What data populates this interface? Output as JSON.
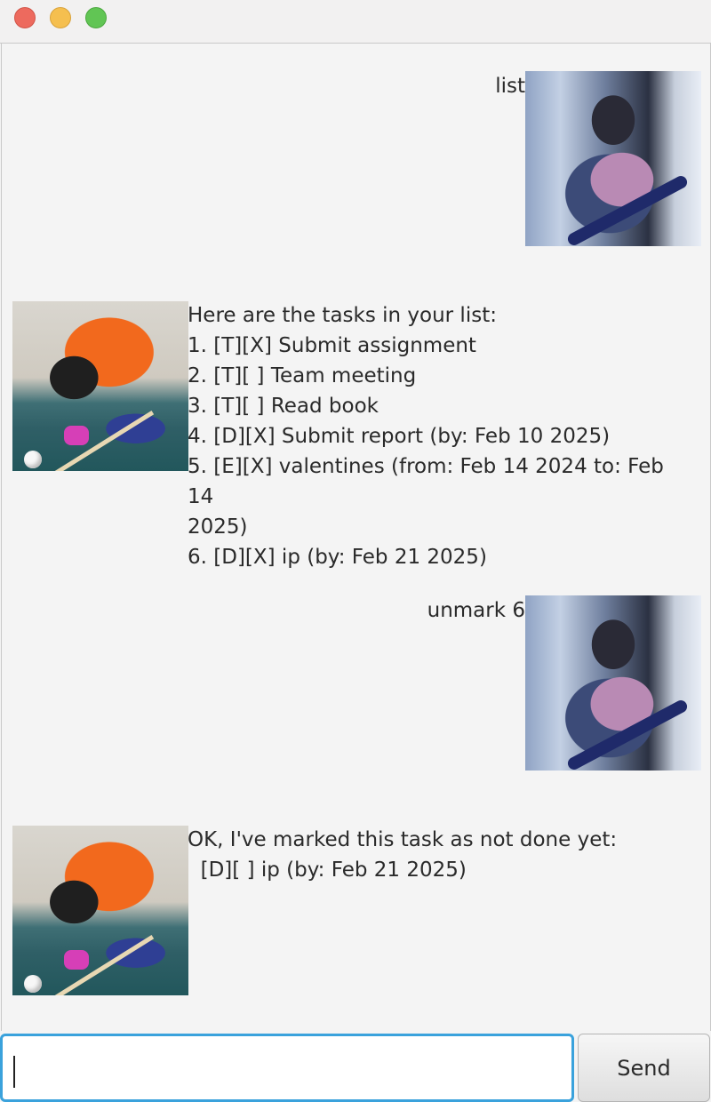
{
  "window": {
    "controls": [
      "close",
      "minimize",
      "zoom"
    ]
  },
  "messages": [
    {
      "role": "user",
      "text": "list",
      "avatar": "guitarist-photo"
    },
    {
      "role": "bot",
      "text": "Here are the tasks in your list:\n1. [T][X] Submit assignment\n2. [T][ ] Team meeting\n3. [T][ ] Read book\n4. [D][X] Submit report (by: Feb 10 2025)\n5. [E][X] valentines (from: Feb 14 2024 to: Feb 14\n2025)\n6. [D][X] ip (by: Feb 21 2025)",
      "avatar": "billiards-player-photo"
    },
    {
      "role": "user",
      "text": "unmark 6",
      "avatar": "guitarist-photo"
    },
    {
      "role": "bot",
      "text": "OK, I've marked this task as not done yet:\n  [D][ ] ip (by: Feb 21 2025)",
      "avatar": "billiards-player-photo"
    }
  ],
  "input": {
    "value": "",
    "placeholder": ""
  },
  "send_button": {
    "label": "Send"
  }
}
